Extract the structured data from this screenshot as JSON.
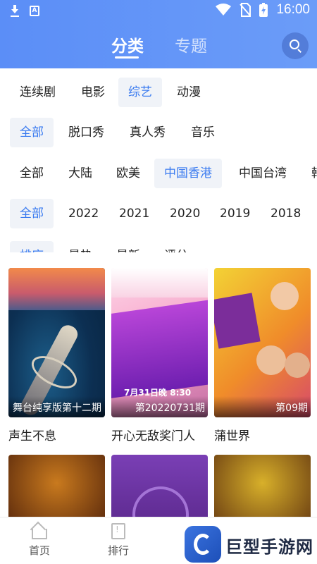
{
  "status_bar": {
    "time": "16:00",
    "icons": [
      "download-icon",
      "a-notification-icon",
      "wifi-icon",
      "no-sim-icon",
      "battery-charging-icon"
    ]
  },
  "header": {
    "tabs": [
      {
        "label": "分类",
        "active": true
      },
      {
        "label": "专题",
        "active": false
      }
    ],
    "search_icon": "search-icon"
  },
  "filters": {
    "type": {
      "options": [
        "连续剧",
        "电影",
        "综艺",
        "动漫"
      ],
      "selected": "综艺"
    },
    "genre": {
      "options": [
        "全部",
        "脱口秀",
        "真人秀",
        "音乐"
      ],
      "selected": "全部"
    },
    "region": {
      "options": [
        "全部",
        "大陆",
        "欧美",
        "中国香港",
        "中国台湾",
        "韩"
      ],
      "selected": "中国香港"
    },
    "year": {
      "options": [
        "全部",
        "2022",
        "2021",
        "2020",
        "2019",
        "2018"
      ],
      "selected": "全部"
    },
    "sort": {
      "options": [
        "排序",
        "最热",
        "最新",
        "评分"
      ],
      "selected": "排序"
    }
  },
  "items": [
    {
      "title": "声生不息",
      "caption": "舞台纯享版第十二期"
    },
    {
      "title": "开心无敌奖门人",
      "caption": "第20220731期",
      "poster_text": "7月31日晚 8:30"
    },
    {
      "title": "蒲世界",
      "caption": "第09期"
    },
    {
      "title": "",
      "caption": ""
    },
    {
      "title": "",
      "caption": ""
    },
    {
      "title": "",
      "caption": ""
    }
  ],
  "bottom_nav": [
    {
      "label": "首页",
      "icon": "home-icon"
    },
    {
      "label": "排行",
      "icon": "ranking-icon"
    }
  ],
  "watermark": {
    "text": "巨型手游网"
  },
  "colors": {
    "header": "#5b8ef7",
    "accent": "#3a7bf0",
    "chip_bg": "#f0f3f8"
  }
}
